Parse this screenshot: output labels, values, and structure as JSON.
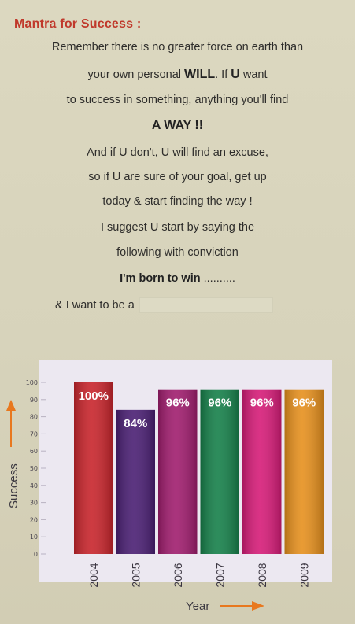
{
  "mantra": {
    "title": "Mantra for Success :",
    "line1": "Remember there is no greater force on earth than",
    "line2_a": "your own personal ",
    "line2_will": "WILL",
    "line2_b": ". If ",
    "line2_u": "U",
    "line2_c": " want",
    "line3": "to success in something, anything you'll find",
    "line4": "A WAY !!",
    "line5": "And if U don't, U will find an excuse,",
    "line6": "so if U are sure of your goal, get up",
    "line7": "today & start finding the way !",
    "line8": "I suggest U start by saying the",
    "line9": "following with conviction",
    "line10": "I'm born to win",
    "line10_dots": " ..........",
    "line11": "& I want to be a"
  },
  "chart_data": {
    "type": "bar",
    "categories": [
      "2004",
      "2005",
      "2006",
      "2007",
      "2008",
      "2009"
    ],
    "values": [
      100,
      84,
      96,
      96,
      96,
      96
    ],
    "data_labels": [
      "100%",
      "84%",
      "96%",
      "96%",
      "96%",
      "96%"
    ],
    "colors": [
      "#c8252c",
      "#4a1f73",
      "#a01d6e",
      "#16804a",
      "#d61c78",
      "#e6901e"
    ],
    "xlabel": "Year",
    "ylabel": "Success",
    "ylim": [
      0,
      100
    ],
    "yticks": [
      0,
      10,
      20,
      30,
      40,
      50,
      60,
      70,
      80,
      90,
      100
    ],
    "arrow_color": "#e8781e"
  }
}
